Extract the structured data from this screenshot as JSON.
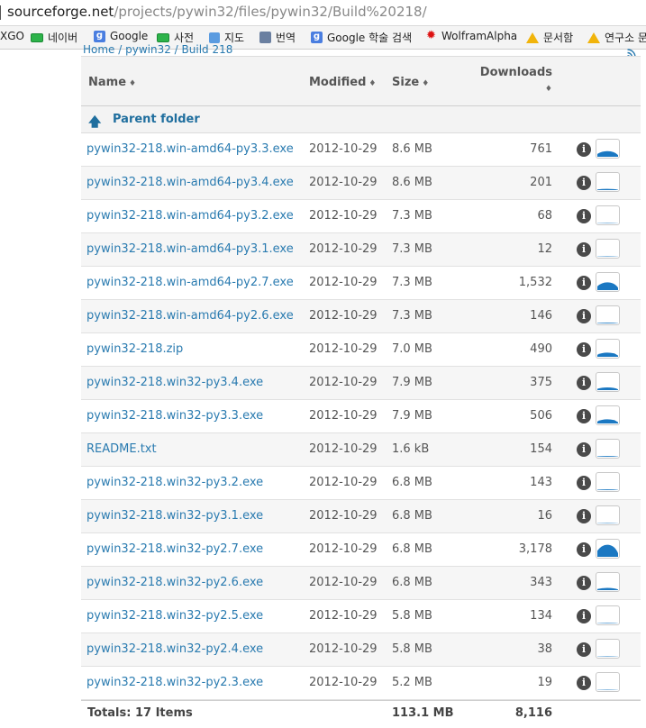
{
  "url": {
    "host": "sourceforge.net",
    "path": "/projects/pywin32/files/pywin32/Build%20218/"
  },
  "bookmarks": [
    {
      "label": "XGO",
      "icon": "none"
    },
    {
      "label": "네이버",
      "icon": "green-box-icon"
    },
    {
      "label": "Google",
      "icon": "google-icon"
    },
    {
      "label": "사전",
      "icon": "green-box-icon"
    },
    {
      "label": "지도",
      "icon": "map-icon"
    },
    {
      "label": "번역",
      "icon": "translate-icon"
    },
    {
      "label": "Google 학술 검색",
      "icon": "google-icon"
    },
    {
      "label": "WolframAlpha",
      "icon": "wolfram-icon"
    },
    {
      "label": "문서함",
      "icon": "drive-icon"
    },
    {
      "label": "연구소 문",
      "icon": "drive-icon"
    }
  ],
  "breadcrumb": "Home / pywin32 / Build 218",
  "table": {
    "headers": {
      "name": "Name",
      "modified": "Modified",
      "size": "Size",
      "downloads": "Downloads",
      "sort_glyph": "♦"
    },
    "parent_folder": "Parent folder",
    "rows": [
      {
        "name": "pywin32-218.win-amd64-py3.3.exe",
        "modified": "2012-10-29",
        "size": "8.6 MB",
        "downloads": "761",
        "trend": 0.45
      },
      {
        "name": "pywin32-218.win-amd64-py3.4.exe",
        "modified": "2012-10-29",
        "size": "8.6 MB",
        "downloads": "201",
        "trend": 0.15
      },
      {
        "name": "pywin32-218.win-amd64-py3.2.exe",
        "modified": "2012-10-29",
        "size": "7.3 MB",
        "downloads": "68",
        "trend": 0.06
      },
      {
        "name": "pywin32-218.win-amd64-py3.1.exe",
        "modified": "2012-10-29",
        "size": "7.3 MB",
        "downloads": "12",
        "trend": 0.03
      },
      {
        "name": "pywin32-218.win-amd64-py2.7.exe",
        "modified": "2012-10-29",
        "size": "7.3 MB",
        "downloads": "1,532",
        "trend": 0.6
      },
      {
        "name": "pywin32-218.win-amd64-py2.6.exe",
        "modified": "2012-10-29",
        "size": "7.3 MB",
        "downloads": "146",
        "trend": 0.12
      },
      {
        "name": "pywin32-218.zip",
        "modified": "2012-10-29",
        "size": "7.0 MB",
        "downloads": "490",
        "trend": 0.35
      },
      {
        "name": "pywin32-218.win32-py3.4.exe",
        "modified": "2012-10-29",
        "size": "7.9 MB",
        "downloads": "375",
        "trend": 0.25
      },
      {
        "name": "pywin32-218.win32-py3.3.exe",
        "modified": "2012-10-29",
        "size": "7.9 MB",
        "downloads": "506",
        "trend": 0.35
      },
      {
        "name": "README.txt",
        "modified": "2012-10-29",
        "size": "1.6 kB",
        "downloads": "154",
        "trend": 0.12
      },
      {
        "name": "pywin32-218.win32-py3.2.exe",
        "modified": "2012-10-29",
        "size": "6.8 MB",
        "downloads": "143",
        "trend": 0.12
      },
      {
        "name": "pywin32-218.win32-py3.1.exe",
        "modified": "2012-10-29",
        "size": "6.8 MB",
        "downloads": "16",
        "trend": 0.04
      },
      {
        "name": "pywin32-218.win32-py2.7.exe",
        "modified": "2012-10-29",
        "size": "6.8 MB",
        "downloads": "3,178",
        "trend": 0.9
      },
      {
        "name": "pywin32-218.win32-py2.6.exe",
        "modified": "2012-10-29",
        "size": "6.8 MB",
        "downloads": "343",
        "trend": 0.22
      },
      {
        "name": "pywin32-218.win32-py2.5.exe",
        "modified": "2012-10-29",
        "size": "5.8 MB",
        "downloads": "134",
        "trend": 0.1
      },
      {
        "name": "pywin32-218.win32-py2.4.exe",
        "modified": "2012-10-29",
        "size": "5.8 MB",
        "downloads": "38",
        "trend": 0.05
      },
      {
        "name": "pywin32-218.win32-py2.3.exe",
        "modified": "2012-10-29",
        "size": "5.2 MB",
        "downloads": "19",
        "trend": 0.04
      }
    ],
    "totals": {
      "label": "Totals: 17 Items",
      "size": "113.1 MB",
      "downloads": "8,116"
    }
  },
  "colors": {
    "link": "#2a7bb0",
    "spark_fill": "#1b78c2"
  }
}
